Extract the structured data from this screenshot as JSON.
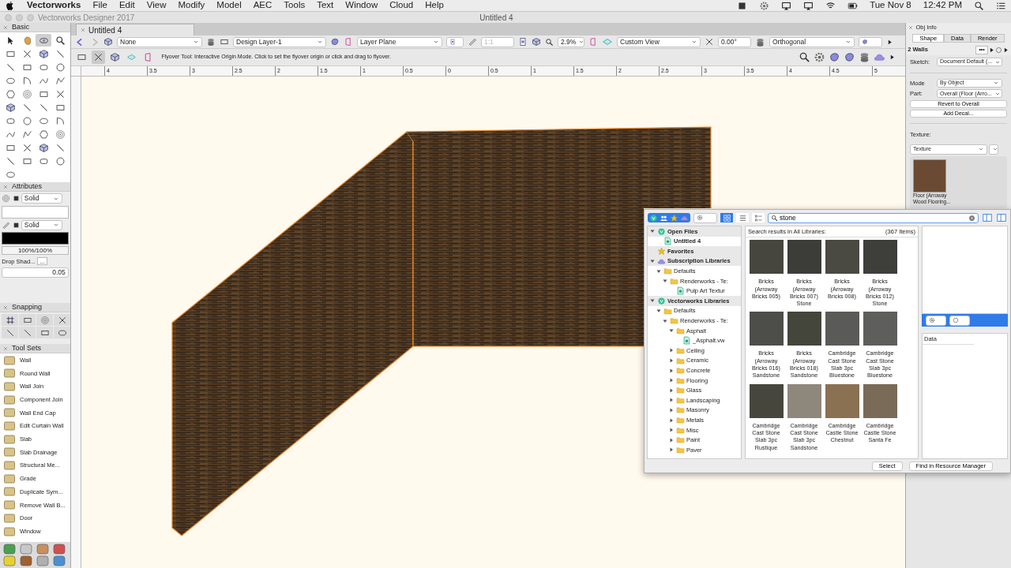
{
  "menubar": {
    "app": "Vectorworks",
    "menus": [
      "File",
      "Edit",
      "View",
      "Modify",
      "Model",
      "AEC",
      "Tools",
      "Text",
      "Window",
      "Cloud",
      "Help"
    ],
    "date": "Tue Nov 8",
    "time": "12:42 PM"
  },
  "window": {
    "title": "Vectorworks Designer 2017",
    "document": "Untitled 4"
  },
  "basic_palette": {
    "title": "Basic",
    "tools": [
      {
        "selected": false
      },
      {
        "selected": false
      },
      {
        "selected": true
      },
      {
        "selected": false
      },
      {
        "selected": false
      },
      {
        "selected": false
      },
      {
        "selected": false
      },
      {
        "selected": false
      },
      {
        "selected": false
      },
      {
        "selected": false
      },
      {
        "selected": false
      },
      {
        "selected": false
      },
      {
        "selected": false
      },
      {
        "selected": false
      },
      {
        "selected": false
      },
      {
        "selected": false
      },
      {
        "selected": false
      },
      {
        "selected": false
      },
      {
        "selected": false
      },
      {
        "selected": false
      },
      {
        "selected": false
      },
      {
        "selected": false
      },
      {
        "selected": false
      },
      {
        "selected": false
      },
      {
        "selected": false
      },
      {
        "selected": false
      },
      {
        "selected": false
      },
      {
        "selected": false
      },
      {
        "selected": false
      },
      {
        "selected": false
      },
      {
        "selected": false
      },
      {
        "selected": false
      },
      {
        "selected": false
      },
      {
        "selected": false
      },
      {
        "selected": false
      },
      {
        "selected": false
      },
      {
        "selected": false
      },
      {
        "selected": false
      },
      {
        "selected": false
      },
      {
        "selected": false
      },
      {
        "selected": false
      }
    ]
  },
  "attributes": {
    "title": "Attributes",
    "fill_style": "Solid",
    "pen_style": "Solid",
    "opacity": "100%/100%",
    "drop_shadow_label": "Drop Shad...",
    "drop_shadow_button": "...",
    "line_weight": "0.05"
  },
  "snapping": {
    "title": "Snapping"
  },
  "tool_sets": {
    "title": "Tool Sets",
    "items": [
      "Wall",
      "Round Wall",
      "Wall Join",
      "Component Join",
      "Wall End Cap",
      "Edit Curtain Wall",
      "Slab",
      "Slab Drainage",
      "Structural Me...",
      "Grade",
      "Duplicate Sym...",
      "Remove Wall B...",
      "Door",
      "Window"
    ]
  },
  "document_tab": {
    "label": "Untitled 4"
  },
  "view_bar": {
    "class": "None",
    "layer": "Design Layer-1",
    "plane": "Layer Plane",
    "scale": "1:1",
    "zoom": "2.9%",
    "view": "Custom View",
    "angle": "0.00°",
    "projection": "Orthogonal"
  },
  "mode_bar": {
    "modes": [
      {
        "selected": false
      },
      {
        "selected": true
      },
      {
        "selected": false
      },
      {
        "selected": false
      },
      {
        "selected": false
      }
    ],
    "message": "Flyover Tool: Interactive Origin Mode. Click to set the flyover origin or click and drag to flyover."
  },
  "ruler": {
    "ticks": [
      "4",
      "3.5",
      "3",
      "2.5",
      "2",
      "1.5",
      "1",
      "0.5",
      "0",
      "0.5",
      "1",
      "1.5",
      "2",
      "2.5",
      "3",
      "3.5",
      "4",
      "4.5",
      "5"
    ]
  },
  "obj_info": {
    "title": "Obj Info",
    "tabs": [
      {
        "label": "Shape",
        "selected": true
      },
      {
        "label": "Data",
        "selected": false
      },
      {
        "label": "Render",
        "selected": false
      }
    ],
    "selection": "2 Walls",
    "more_button": "•••",
    "sections": [
      [
        {
          "label": "Sketch:",
          "value": "Document Default (..."
        }
      ],
      [
        {
          "label": "Mode",
          "value": "By Object"
        },
        {
          "label": "Part:",
          "value": "Overall (Floor (Arro..."
        }
      ]
    ],
    "buttons": [
      "Revert to Overall",
      "Add Decal..."
    ],
    "texture_label": "Texture:",
    "texture_value": "Texture",
    "swatch_label": "Floor (Arroway Wood Flooring..."
  },
  "resource_browser": {
    "search": "stone",
    "view_modes": [
      {
        "selected": true
      },
      {
        "selected": false
      },
      {
        "selected": false
      }
    ],
    "results_label": "Search results in All Libraries:",
    "count": "(367 Items)",
    "tree": [
      {
        "label": "Open Files",
        "kind": "document-group",
        "expanded": true,
        "children": [
          {
            "label": "Untitled 4",
            "kind": "document"
          }
        ]
      },
      {
        "label": "Favorites",
        "kind": "favorites"
      },
      {
        "label": "Subscription Libraries",
        "kind": "cloud-library",
        "expanded": true,
        "children": [
          {
            "label": "Defaults",
            "kind": "folder",
            "expanded": true,
            "children": [
              {
                "label": "Renderworks - Te:",
                "kind": "folder",
                "expanded": true,
                "children": [
                  {
                    "label": "Pulp Art Textur",
                    "kind": "resource"
                  }
                ]
              }
            ]
          }
        ]
      },
      {
        "label": "Vectorworks Libraries",
        "kind": "library",
        "expanded": true,
        "children": [
          {
            "label": "Defaults",
            "kind": "folder",
            "expanded": true,
            "children": [
              {
                "label": "Renderworks - Te:",
                "kind": "folder",
                "expanded": true,
                "children": [
                  {
                    "label": "Asphalt",
                    "kind": "folder",
                    "expanded": true,
                    "children": [
                      {
                        "label": "_Asphalt.vw",
                        "kind": "resource"
                      }
                    ]
                  },
                  {
                    "label": "Ceiling",
                    "kind": "folder",
                    "expanded": false
                  },
                  {
                    "label": "Ceramic",
                    "kind": "folder",
                    "expanded": false
                  },
                  {
                    "label": "Concrete",
                    "kind": "folder",
                    "expanded": false
                  },
                  {
                    "label": "Flooring",
                    "kind": "folder",
                    "expanded": false
                  },
                  {
                    "label": "Glass",
                    "kind": "folder",
                    "expanded": false
                  },
                  {
                    "label": "Landscaping",
                    "kind": "folder",
                    "expanded": false
                  },
                  {
                    "label": "Masonry",
                    "kind": "folder",
                    "expanded": false
                  },
                  {
                    "label": "Metals",
                    "kind": "folder",
                    "expanded": false
                  },
                  {
                    "label": "Misc",
                    "kind": "folder",
                    "expanded": false
                  },
                  {
                    "label": "Paint",
                    "kind": "folder",
                    "expanded": false
                  },
                  {
                    "label": "Paver",
                    "kind": "folder",
                    "expanded": false
                  }
                ]
              }
            ]
          }
        ]
      }
    ],
    "items": [
      {
        "name": "Bricks (Arroway Bricks 005)",
        "color": "#46463f"
      },
      {
        "name": "Bricks (Arroway Bricks 007) Stone",
        "color": "#3c3d38"
      },
      {
        "name": "Bricks (Arroway Bricks 008)",
        "color": "#4a4a42"
      },
      {
        "name": "Bricks (Arroway Bricks 012) Stone",
        "color": "#3e3f3b"
      },
      {
        "name": "Bricks (Arroway Bricks 016) Sandstone",
        "color": "#4d4d4a"
      },
      {
        "name": "Bricks (Arroway Bricks 018) Sandstone",
        "color": "#45463b"
      },
      {
        "name": "Cambridge Cast Stone Slab 3pc Bluestone",
        "color": "#5a5a58"
      },
      {
        "name": "Cambridge Cast Stone Slab 3pc Bluestone",
        "color": "#5e5e5c"
      },
      {
        "name": "Cambridge Cast Stone Slab 3pc Rustique",
        "color": "#47463d"
      },
      {
        "name": "Cambridge Cast Stone Slab 3pc Sandstone",
        "color": "#8e877c"
      },
      {
        "name": "Cambridge Castle Stone Chestnut",
        "color": "#8a7152"
      },
      {
        "name": "Cambridge Castle Stone Santa Fe",
        "color": "#7a6a58"
      }
    ],
    "preview_header": "Data",
    "buttons": [
      "Select",
      "Find in Resource Manager"
    ]
  }
}
